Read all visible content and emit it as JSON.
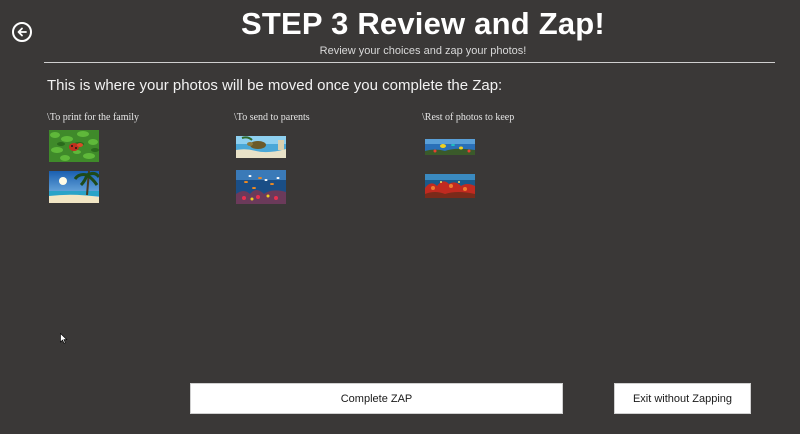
{
  "header": {
    "title": "STEP 3 Review and Zap!",
    "subtitle": "Review your choices and zap your photos!",
    "back_icon": "back-arrow-circle-icon"
  },
  "intro_text": "This is where your photos will be moved once you complete the Zap:",
  "folders": [
    {
      "label": "\\To print for the family",
      "photos": [
        "green-leaves-ladybug",
        "tropical-beach-palm"
      ]
    },
    {
      "label": "\\To send to parents",
      "photos": [
        "sea-turtle-coral",
        "coral-reef-fish"
      ]
    },
    {
      "label": "\\Rest of photos to keep",
      "photos": [
        "tropical-fish-reef",
        "red-coral-reef"
      ]
    }
  ],
  "buttons": {
    "complete": "Complete ZAP",
    "exit": "Exit without Zapping"
  },
  "colors": {
    "background": "#3a3837",
    "text": "#ffffff",
    "button_bg": "#ffffff"
  }
}
